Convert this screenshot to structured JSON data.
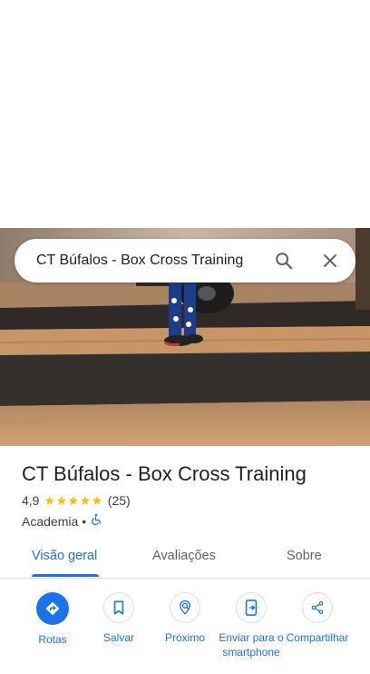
{
  "search": {
    "query": "CT Búfalos - Box Cross Training"
  },
  "place": {
    "name": "CT Búfalos - Box Cross Training",
    "rating": "4,9",
    "stars": 5,
    "review_count": "(25)",
    "category": "Academia",
    "separator": "•"
  },
  "tabs": [
    {
      "label": "Visão geral",
      "active": true
    },
    {
      "label": "Avaliações",
      "active": false
    },
    {
      "label": "Sobre",
      "active": false
    }
  ],
  "actions": [
    {
      "label": "Rotas",
      "icon": "directions-icon"
    },
    {
      "label": "Salvar",
      "icon": "bookmark-icon"
    },
    {
      "label": "Próximo",
      "icon": "nearby-icon"
    },
    {
      "label": "Enviar para o smartphone",
      "icon": "send-to-phone-icon"
    },
    {
      "label": "Compartilhar",
      "icon": "share-icon"
    }
  ],
  "colors": {
    "accent": "#1a73e8",
    "star": "#fbbc04",
    "text": "#202124",
    "secondary_text": "#5f6368"
  }
}
